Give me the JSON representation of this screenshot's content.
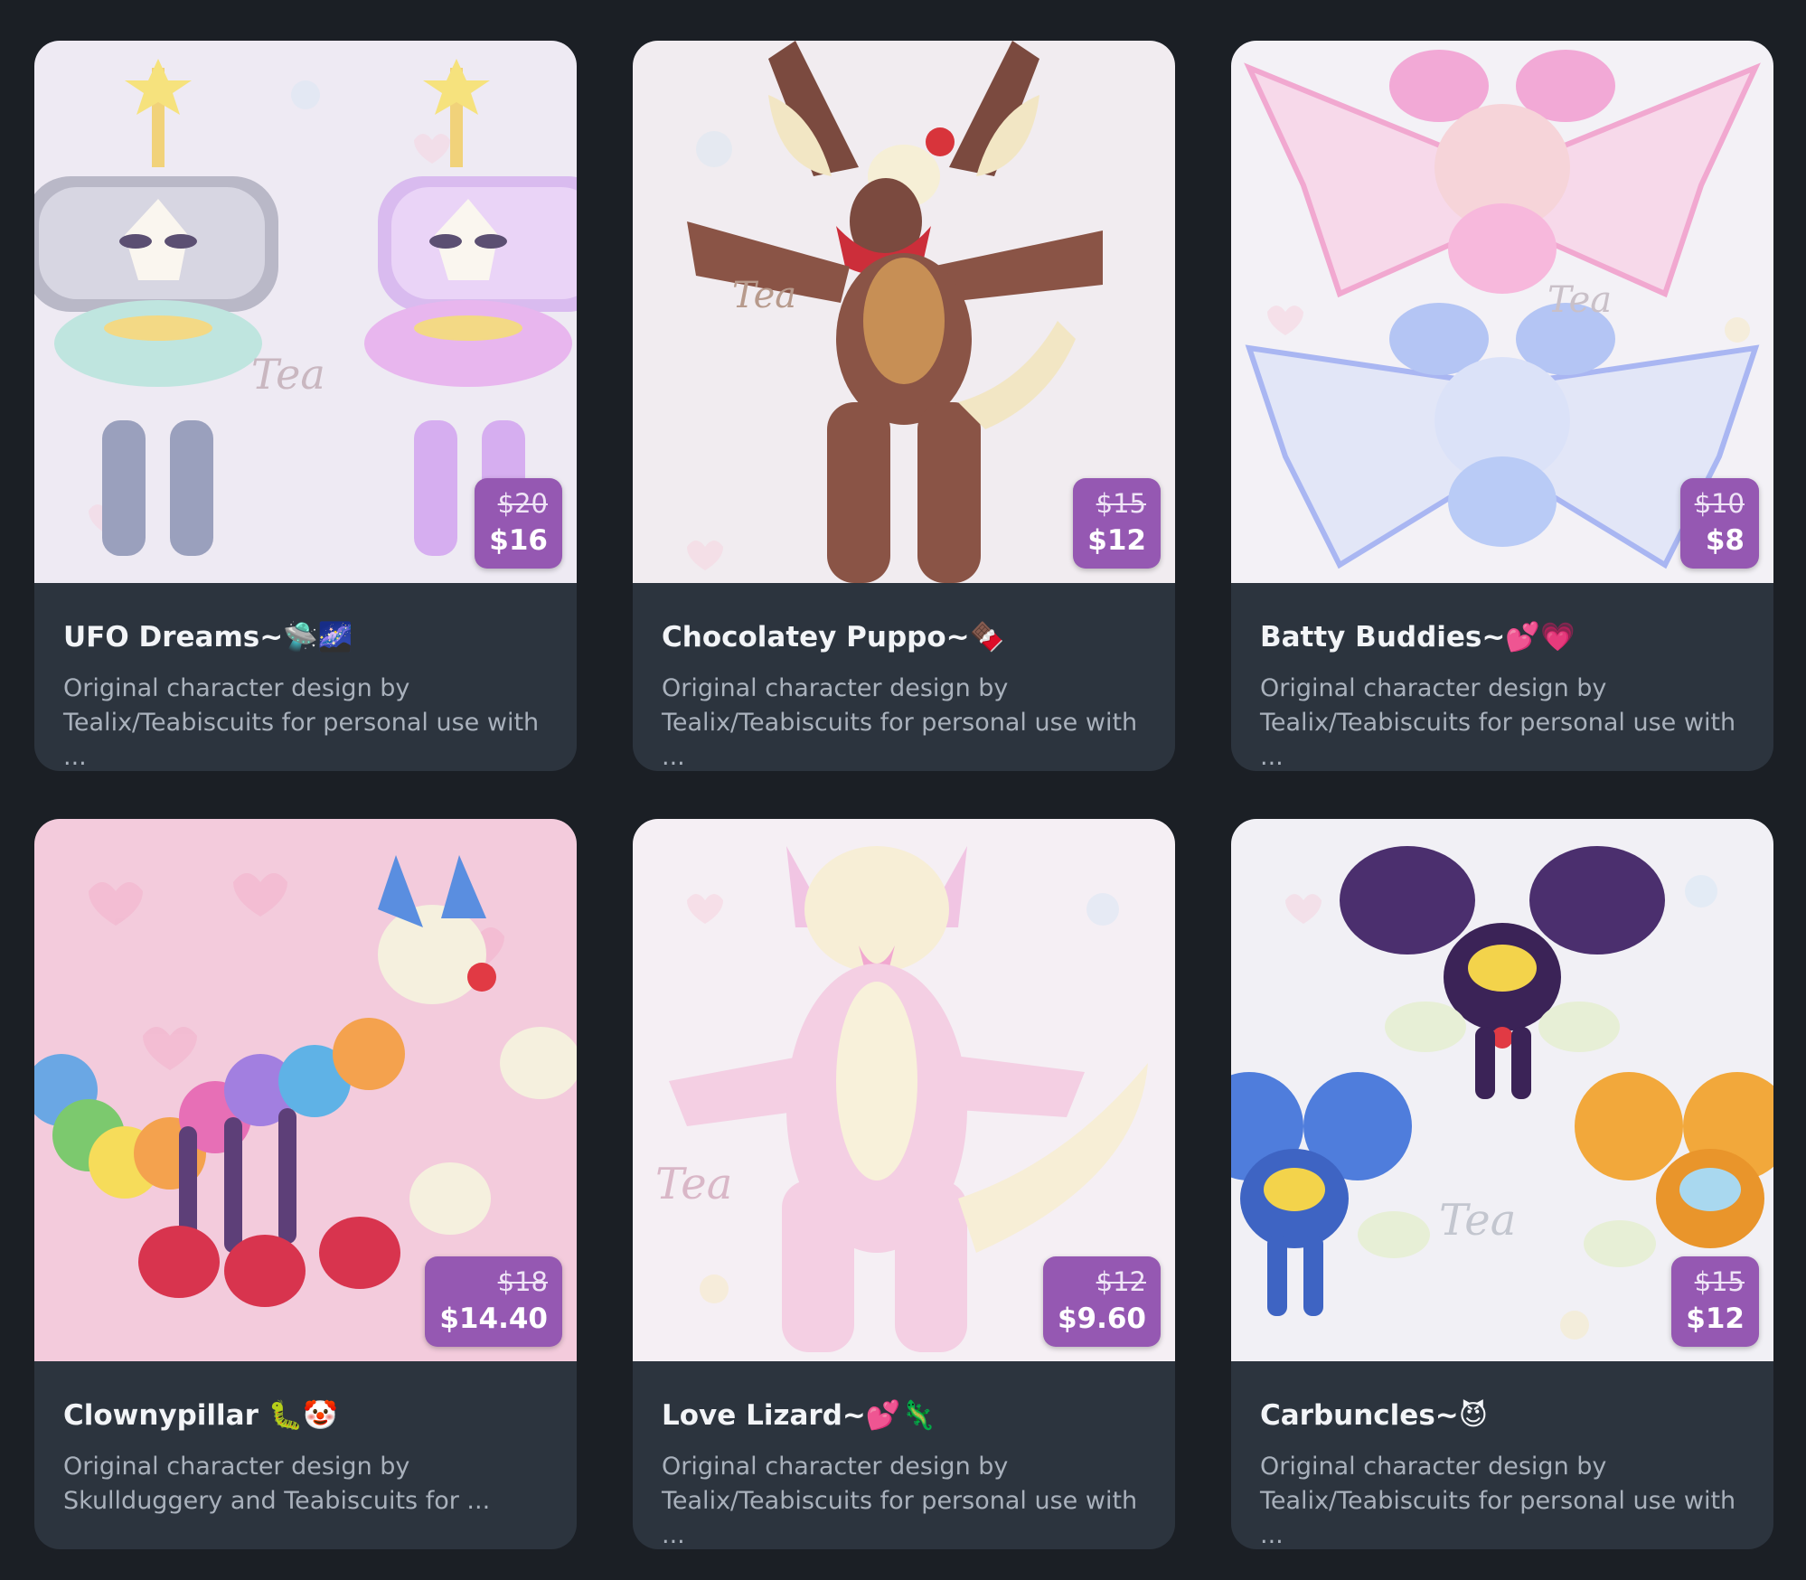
{
  "cards": [
    {
      "title": "UFO Dreams~🛸🌌",
      "description": "Original character design by\nTealix/Teabiscuits for personal use with ...",
      "old_price": "$20",
      "price": "$16",
      "image": {
        "bg": "#eeeaf3",
        "icon": "ufo-characters-art",
        "watermark": "Tea"
      }
    },
    {
      "title": "Chocolatey Puppo~🍫",
      "description": "Original character design by\nTealix/Teabiscuits for personal use with ...",
      "old_price": "$15",
      "price": "$12",
      "image": {
        "bg": "#f1ecf0",
        "icon": "chocolate-puppy-art",
        "watermark": "Tea"
      }
    },
    {
      "title": "Batty Buddies~💕💗",
      "description": "Original character design by\nTealix/Teabiscuits for personal use with ...",
      "old_price": "$10",
      "price": "$8",
      "image": {
        "bg": "#f3f1f6",
        "icon": "bat-bunnies-art",
        "watermark": "Tea"
      }
    },
    {
      "title": "Clownypillar 🐛🤡",
      "description": "Original character design by\nSkullduggery and  Teabiscuits for ...",
      "old_price": "$18",
      "price": "$14.40",
      "image": {
        "bg": "#f3cbdc",
        "icon": "clown-caterpillar-art",
        "watermark": ""
      }
    },
    {
      "title": "Love Lizard~💕🦎",
      "description": "Original character design by\nTealix/Teabiscuits for personal use with ...",
      "old_price": "$12",
      "price": "$9.60",
      "image": {
        "bg": "#f5eff4",
        "icon": "love-lizard-art",
        "watermark": "Tea"
      }
    },
    {
      "title": "Carbuncles~😈",
      "description": "Original character design by\nTealix/Teabiscuits for personal use with ...",
      "old_price": "$15",
      "price": "$12",
      "image": {
        "bg": "#f1f0f5",
        "icon": "carbuncles-art",
        "watermark": "Tea"
      }
    }
  ]
}
